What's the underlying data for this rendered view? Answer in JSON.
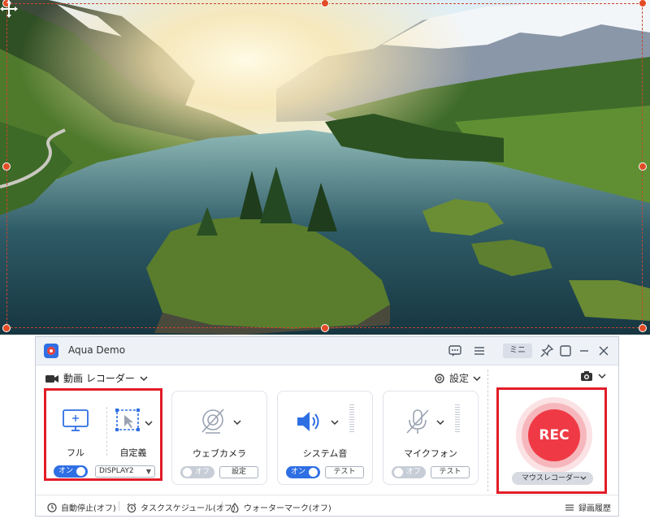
{
  "scene": {
    "description_icon": "move-cross-icon"
  },
  "app": {
    "title": "Aqua Demo",
    "mini_label": "ミニ",
    "record_mode": "動画 レコーダー",
    "settings_label": "設定",
    "sources": [
      {
        "label": "フル",
        "toggle": "オン",
        "toggle_state": "on",
        "extra": "DISPLAY2"
      },
      {
        "label": "自定義"
      },
      {
        "label": "ウェブカメラ",
        "toggle": "オフ",
        "toggle_state": "off",
        "button": "設定"
      },
      {
        "label": "システム音",
        "toggle": "オン",
        "toggle_state": "on",
        "button": "テスト"
      },
      {
        "label": "マイクフォン",
        "toggle": "オフ",
        "toggle_state": "off",
        "button": "テスト"
      }
    ],
    "rec_label": "REC",
    "mouse_recorder": "マウスレコーダー",
    "status": {
      "auto_stop": "自動停止(オフ)",
      "task_schedule": "タスクスケジュール(オフ)",
      "watermark": "ウォーターマーク(オフ)",
      "history": "録画履歴"
    }
  },
  "colors": {
    "accent": "#2f6fe4",
    "rec": "#ef3a45",
    "highlight": "#e21c27",
    "crop": "#e34b26"
  }
}
